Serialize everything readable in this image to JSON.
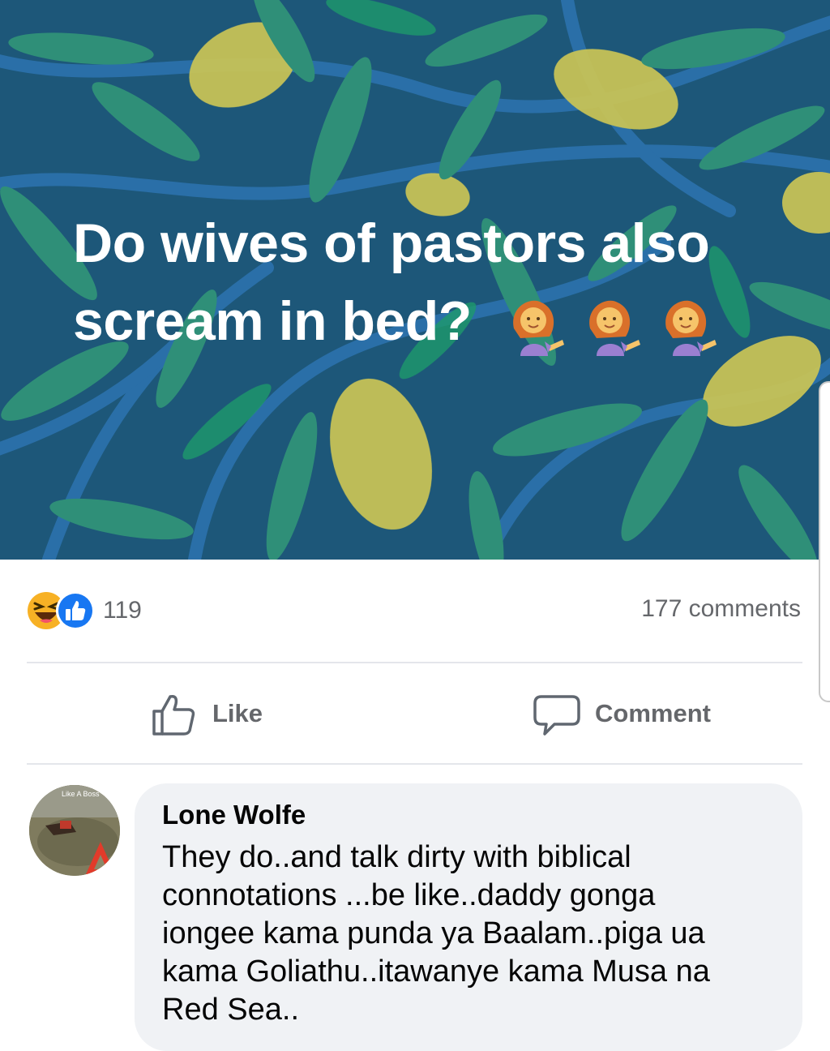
{
  "post": {
    "line1": "Do wives of pastors also",
    "line2": "scream in bed?",
    "emojis": [
      "woman-tipping-hand-emoji",
      "woman-tipping-hand-emoji",
      "woman-tipping-hand-emoji"
    ],
    "background_colors": {
      "base": "#1d5779",
      "leaf": "#2f8f78",
      "lemon": "#c7c257",
      "branch": "#2a6fa8"
    }
  },
  "reactions": {
    "icons": [
      "haha-reaction-icon",
      "like-reaction-icon"
    ],
    "count": "119",
    "comments": "177 comments"
  },
  "actions": {
    "like_label": "Like",
    "comment_label": "Comment"
  },
  "comment": {
    "author": "Lone Wolfe",
    "avatar_caption": "Like A Boss",
    "lines": [
      "They do..and talk dirty with biblical",
      "connotations ...be like..daddy gonga",
      "iongee kama punda ya Baalam..piga ua",
      "kama Goliathu..itawanye kama Musa na",
      "Red Sea.."
    ]
  },
  "colors": {
    "accent": "#1877f2",
    "secondary_text": "#65676b",
    "bubble": "#f0f2f5"
  }
}
